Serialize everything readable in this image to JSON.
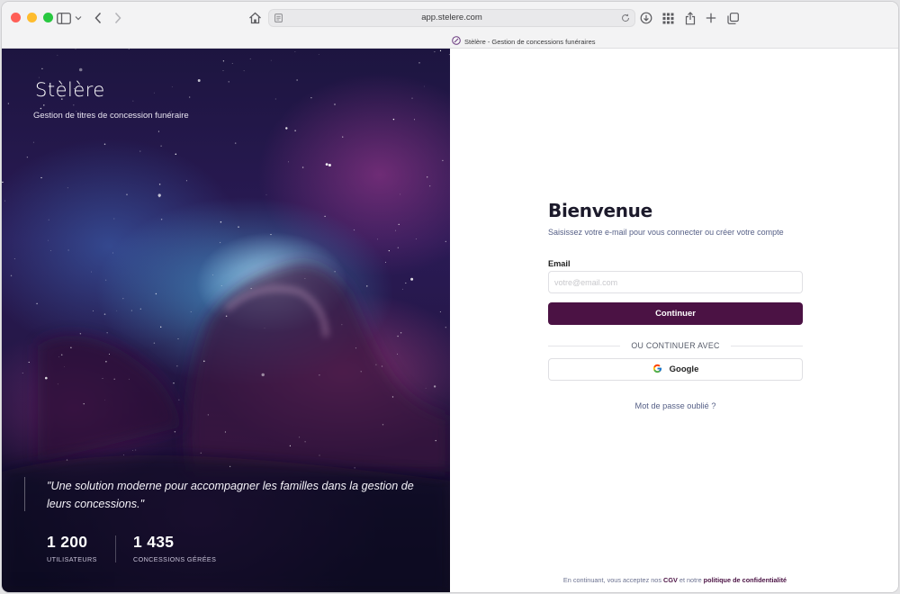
{
  "browser": {
    "url": "app.stelere.com",
    "tab_title": "Stèlère - Gestion de concessions funéraires",
    "traffic_lights": {
      "close": "#ff5f57",
      "minimize": "#febc2e",
      "zoom": "#28c840"
    }
  },
  "hero": {
    "brand": "Stèlère",
    "tagline": "Gestion de titres de concession funéraire",
    "quote": "\"Une solution moderne pour accompagner les familles dans la gestion de leurs concessions.\"",
    "stats": [
      {
        "value": "1 200",
        "label": "UTILISATEURS"
      },
      {
        "value": "1 435",
        "label": "CONCESSIONS GÉRÉES"
      }
    ]
  },
  "login": {
    "title": "Bienvenue",
    "subtitle": "Saisissez votre e-mail pour vous connecter ou créer votre compte",
    "email_label": "Email",
    "email_placeholder": "votre@email.com",
    "email_value": "",
    "continue_label": "Continuer",
    "divider": "OU CONTINUER AVEC",
    "google_label": "Google",
    "forgot_label": "Mot de passe oublié ?",
    "footer_prefix": "En continuant, vous acceptez nos",
    "footer_cgv": "CGV",
    "footer_middle": "et notre",
    "footer_privacy": "politique de confidentialité"
  },
  "colors": {
    "primary": "#4b1244",
    "muted_text": "#555f86"
  },
  "icons": {
    "sidebar": "sidebar-icon",
    "back": "chevron-left-icon",
    "forward": "chevron-right-icon",
    "home": "home-icon",
    "reader": "reader-icon",
    "reload": "reload-icon",
    "download": "download-icon",
    "extensions": "grid-icon",
    "share": "share-icon",
    "new_tab": "plus-icon",
    "tabs": "tabs-icon",
    "google": "google-icon"
  }
}
